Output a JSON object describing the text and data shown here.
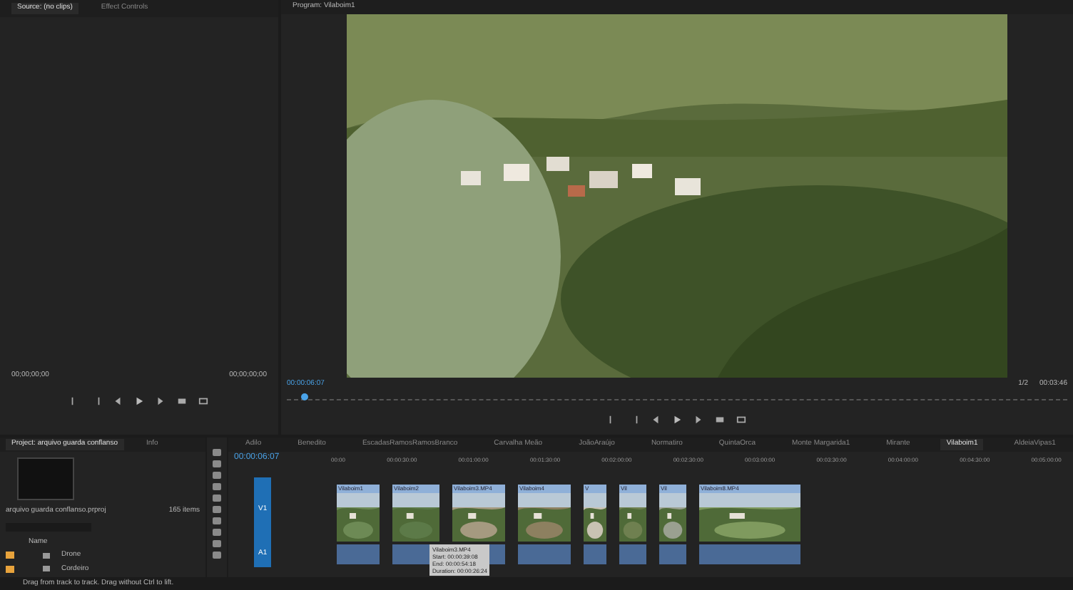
{
  "source_panel": {
    "tabs": [
      {
        "label": "Source: (no clips)",
        "selected": true
      },
      {
        "label": "Effect Controls",
        "selected": false
      }
    ],
    "timecode_in": "00;00;00;00",
    "timecode_out": "00;00;00;00"
  },
  "program_panel": {
    "title": "Program: Vilaboim1",
    "timecode": "00:00:06:07",
    "zoom": "1/2",
    "duration": "00:03:46"
  },
  "project_panel": {
    "tabs": [
      {
        "label": "Project: arquivo guarda conflanso",
        "selected": true
      },
      {
        "label": "Info",
        "selected": false
      }
    ],
    "file": "arquivo guarda conflanso.prproj",
    "count": "165 items",
    "column": "Name",
    "bins": [
      {
        "name": "Drone",
        "color": "#e8a33c"
      },
      {
        "name": "Cordeiro",
        "color": "#e8a33c"
      }
    ]
  },
  "timeline": {
    "tabs": [
      {
        "label": "Adilo",
        "selected": false
      },
      {
        "label": "Benedito",
        "selected": false
      },
      {
        "label": "EscadasRamosRamosBranco",
        "selected": false
      },
      {
        "label": "Carvalha Meão",
        "selected": false
      },
      {
        "label": "JoãoAraújo",
        "selected": false
      },
      {
        "label": "Normatiro",
        "selected": false
      },
      {
        "label": "QuintaOrca",
        "selected": false
      },
      {
        "label": "Monte Margarida1",
        "selected": false
      },
      {
        "label": "Mirante",
        "selected": false
      },
      {
        "label": "Vilaboim1",
        "selected": true
      },
      {
        "label": "AldeiaVipas1",
        "selected": false
      }
    ],
    "timecode": "00:00:06:07",
    "ruler": [
      "00:00",
      "00:00:30:00",
      "00:01:00:00",
      "00:01:30:00",
      "00:02:00:00",
      "00:02:30:00",
      "00:03:00:00",
      "00:03:30:00",
      "00:04:00:00",
      "00:04:30:00",
      "00:05:00:00"
    ],
    "tracks": [
      {
        "label": "V1"
      },
      {
        "label": "A1"
      }
    ],
    "clips": [
      {
        "label": "Vilaboim1"
      },
      {
        "label": "Vilaboim2"
      },
      {
        "label": "Vilaboim3.MP4"
      },
      {
        "label": "Vilaboim4"
      },
      {
        "label": "V"
      },
      {
        "label": "Vil"
      },
      {
        "label": "Vil"
      },
      {
        "label": "Vilaboim8.MP4"
      }
    ],
    "tooltip": [
      "Vilaboim3.MP4",
      "Start: 00:00:39:08",
      "End: 00:00:54:18",
      "Duration: 00:00:26:24"
    ]
  },
  "status_bar": "Drag from track to track. Drag without Ctrl to lift."
}
